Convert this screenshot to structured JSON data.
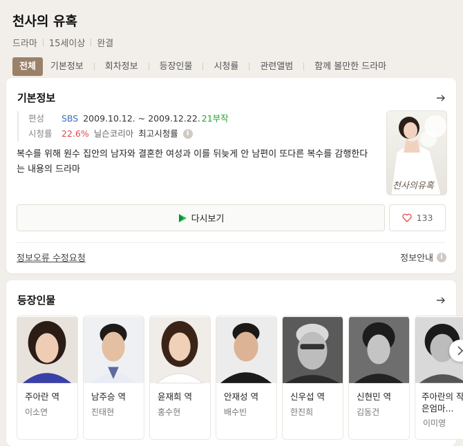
{
  "title": "천사의 유혹",
  "meta": [
    "드라마",
    "15세이상",
    "완결"
  ],
  "tabs": [
    "전체",
    "기본정보",
    "회차정보",
    "등장인물",
    "시청률",
    "관련앨범",
    "함께 볼만한 드라마"
  ],
  "basic": {
    "heading": "기본정보",
    "broadcast_label": "편성",
    "channel": "SBS",
    "period": "2009.10.12. ~ 2009.12.22.",
    "episodes": "21부작",
    "rating_label": "시청률",
    "rating": "22.6%",
    "rating_source": "닐슨코리아",
    "rating_type": "최고시청률",
    "description": "복수를 위해 원수 집안의 남자와 결혼한 여성과 이를 뒤늦게 안 남편이 또다른 복수를 감행한다는 내용의 드라마",
    "poster_text": "천사의유혹",
    "watch_label": "다시보기",
    "like_count": "133",
    "report_label": "정보오류 수정요청",
    "guide_label": "정보안내"
  },
  "cast": {
    "heading": "등장인물",
    "people": [
      {
        "role": "주아란 역",
        "actor": "이소연"
      },
      {
        "role": "남주승 역",
        "actor": "진태현"
      },
      {
        "role": "윤재희 역",
        "actor": "홍수현"
      },
      {
        "role": "안재성 역",
        "actor": "배수빈"
      },
      {
        "role": "신우섭 역",
        "actor": "한진희"
      },
      {
        "role": "신현민 역",
        "actor": "김동건"
      },
      {
        "role": "주아란의 작은엄마...",
        "actor": "이미영"
      }
    ]
  },
  "colors": {
    "accent": "#9a8168",
    "rating": "#e04848",
    "episodes": "#21a32a",
    "channel": "#3a6fb7"
  }
}
